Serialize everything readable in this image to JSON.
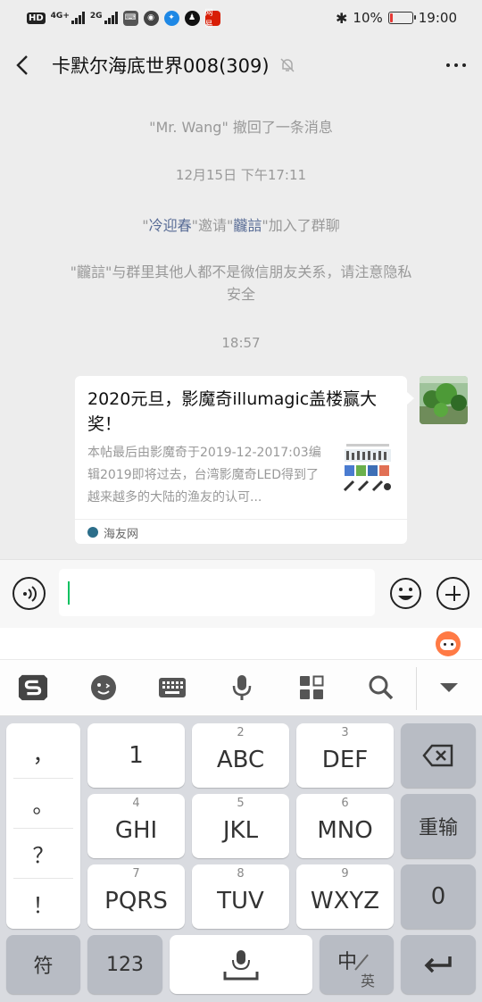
{
  "status_bar": {
    "left_badge": "HD",
    "net1": "4G+",
    "net2": "2G",
    "battery": "10%",
    "time": "19:00",
    "notif_app": "网易"
  },
  "header": {
    "title": "卡默尔海底世界008(309)"
  },
  "messages": {
    "recall": "\"Mr. Wang\" 撤回了一条消息",
    "time1": "12月15日 下午17:11",
    "invite_q1": "\"",
    "invite_inviter": "冷迎春",
    "invite_q2": "\"邀请\"",
    "invite_invitee": "龖誩",
    "invite_suffix": "\"加入了群聊",
    "notice_line1": "\"龖誩\"与群里其他人都不是微信朋友关系，请注意隐私",
    "notice_line2": "安全",
    "time2": "18:57"
  },
  "card": {
    "title": "2020元旦，影魔奇illumagic盖楼赢大奖！",
    "desc": "本帖最后由影魔奇于2019-12-2017:03编辑2019即将过去，台湾影魔奇LED得到了越来越多的大陆的渔友的认可...",
    "source": "海友网"
  },
  "keyboard": {
    "punct": [
      "，",
      "。",
      "？",
      "！"
    ],
    "row1": [
      {
        "num": "",
        "label": "1"
      },
      {
        "num": "2",
        "label": "ABC"
      },
      {
        "num": "3",
        "label": "DEF"
      }
    ],
    "row2": [
      {
        "num": "4",
        "label": "GHI"
      },
      {
        "num": "5",
        "label": "JKL"
      },
      {
        "num": "6",
        "label": "MNO"
      }
    ],
    "row3": [
      {
        "num": "7",
        "label": "PQRS"
      },
      {
        "num": "8",
        "label": "TUV"
      },
      {
        "num": "9",
        "label": "WXYZ"
      }
    ],
    "retype": "重输",
    "zero": "0",
    "symbols": "符",
    "num_switch": "123",
    "lang_main": "中",
    "lang_sub": "英"
  },
  "colors": {
    "accent": "#07c160",
    "link": "#576b95",
    "battery_low": "#e53935"
  }
}
